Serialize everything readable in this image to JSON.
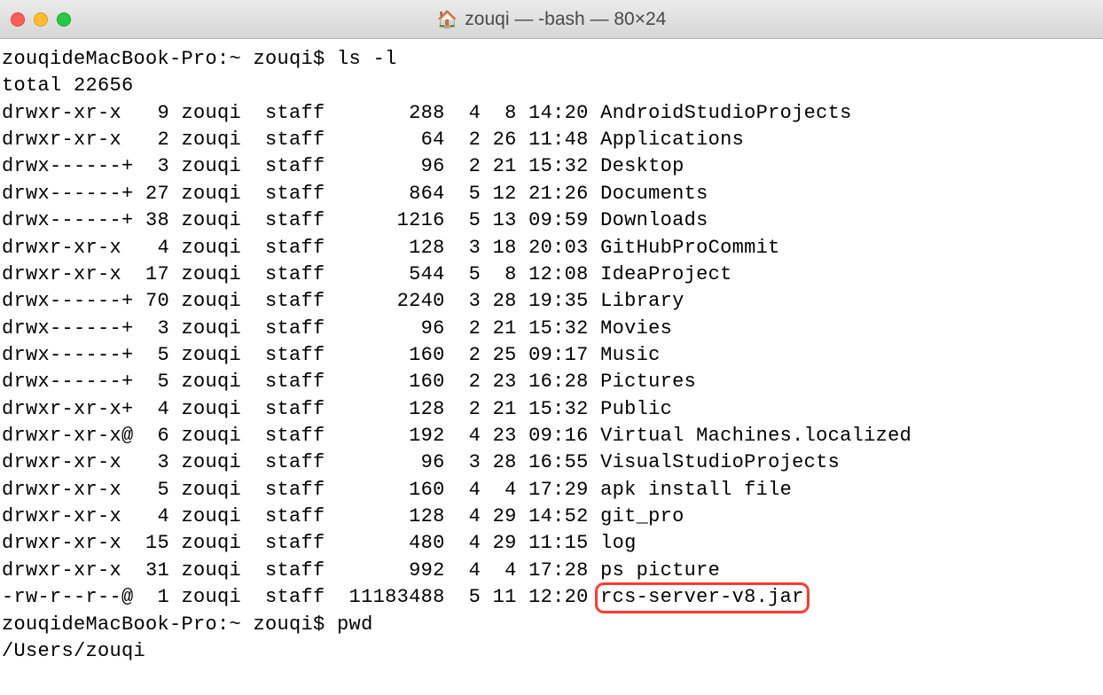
{
  "window": {
    "title": "zouqi — -bash — 80×24"
  },
  "prompt1": {
    "host": "zouqideMacBook-Pro",
    "path": "~",
    "user": "zouqi",
    "symbol": "$",
    "command": "ls -l"
  },
  "total_line": "total 22656",
  "listing": [
    {
      "perm": "drwxr-xr-x ",
      "links": " 9",
      "owner": "zouqi",
      "group": "staff",
      "size": "     288",
      "date": " 4  8 14:20",
      "name": "AndroidStudioProjects"
    },
    {
      "perm": "drwxr-xr-x ",
      "links": " 2",
      "owner": "zouqi",
      "group": "staff",
      "size": "      64",
      "date": " 2 26 11:48",
      "name": "Applications"
    },
    {
      "perm": "drwx------+",
      "links": " 3",
      "owner": "zouqi",
      "group": "staff",
      "size": "      96",
      "date": " 2 21 15:32",
      "name": "Desktop"
    },
    {
      "perm": "drwx------+",
      "links": "27",
      "owner": "zouqi",
      "group": "staff",
      "size": "     864",
      "date": " 5 12 21:26",
      "name": "Documents"
    },
    {
      "perm": "drwx------+",
      "links": "38",
      "owner": "zouqi",
      "group": "staff",
      "size": "    1216",
      "date": " 5 13 09:59",
      "name": "Downloads"
    },
    {
      "perm": "drwxr-xr-x ",
      "links": " 4",
      "owner": "zouqi",
      "group": "staff",
      "size": "     128",
      "date": " 3 18 20:03",
      "name": "GitHubProCommit"
    },
    {
      "perm": "drwxr-xr-x ",
      "links": "17",
      "owner": "zouqi",
      "group": "staff",
      "size": "     544",
      "date": " 5  8 12:08",
      "name": "IdeaProject"
    },
    {
      "perm": "drwx------+",
      "links": "70",
      "owner": "zouqi",
      "group": "staff",
      "size": "    2240",
      "date": " 3 28 19:35",
      "name": "Library"
    },
    {
      "perm": "drwx------+",
      "links": " 3",
      "owner": "zouqi",
      "group": "staff",
      "size": "      96",
      "date": " 2 21 15:32",
      "name": "Movies"
    },
    {
      "perm": "drwx------+",
      "links": " 5",
      "owner": "zouqi",
      "group": "staff",
      "size": "     160",
      "date": " 2 25 09:17",
      "name": "Music"
    },
    {
      "perm": "drwx------+",
      "links": " 5",
      "owner": "zouqi",
      "group": "staff",
      "size": "     160",
      "date": " 2 23 16:28",
      "name": "Pictures"
    },
    {
      "perm": "drwxr-xr-x+",
      "links": " 4",
      "owner": "zouqi",
      "group": "staff",
      "size": "     128",
      "date": " 2 21 15:32",
      "name": "Public"
    },
    {
      "perm": "drwxr-xr-x@",
      "links": " 6",
      "owner": "zouqi",
      "group": "staff",
      "size": "     192",
      "date": " 4 23 09:16",
      "name": "Virtual Machines.localized"
    },
    {
      "perm": "drwxr-xr-x ",
      "links": " 3",
      "owner": "zouqi",
      "group": "staff",
      "size": "      96",
      "date": " 3 28 16:55",
      "name": "VisualStudioProjects"
    },
    {
      "perm": "drwxr-xr-x ",
      "links": " 5",
      "owner": "zouqi",
      "group": "staff",
      "size": "     160",
      "date": " 4  4 17:29",
      "name": "apk install file"
    },
    {
      "perm": "drwxr-xr-x ",
      "links": " 4",
      "owner": "zouqi",
      "group": "staff",
      "size": "     128",
      "date": " 4 29 14:52",
      "name": "git_pro"
    },
    {
      "perm": "drwxr-xr-x ",
      "links": "15",
      "owner": "zouqi",
      "group": "staff",
      "size": "     480",
      "date": " 4 29 11:15",
      "name": "log"
    },
    {
      "perm": "drwxr-xr-x ",
      "links": "31",
      "owner": "zouqi",
      "group": "staff",
      "size": "     992",
      "date": " 4  4 17:28",
      "name": "ps picture"
    },
    {
      "perm": "-rw-r--r--@",
      "links": " 1",
      "owner": "zouqi",
      "group": "staff",
      "size": "11183488",
      "date": " 5 11 12:20",
      "name": "rcs-server-v8.jar",
      "highlight": true
    }
  ],
  "prompt2": {
    "host": "zouqideMacBook-Pro",
    "path": "~",
    "user": "zouqi",
    "symbol": "$",
    "command": "pwd"
  },
  "pwd_output": "/Users/zouqi"
}
